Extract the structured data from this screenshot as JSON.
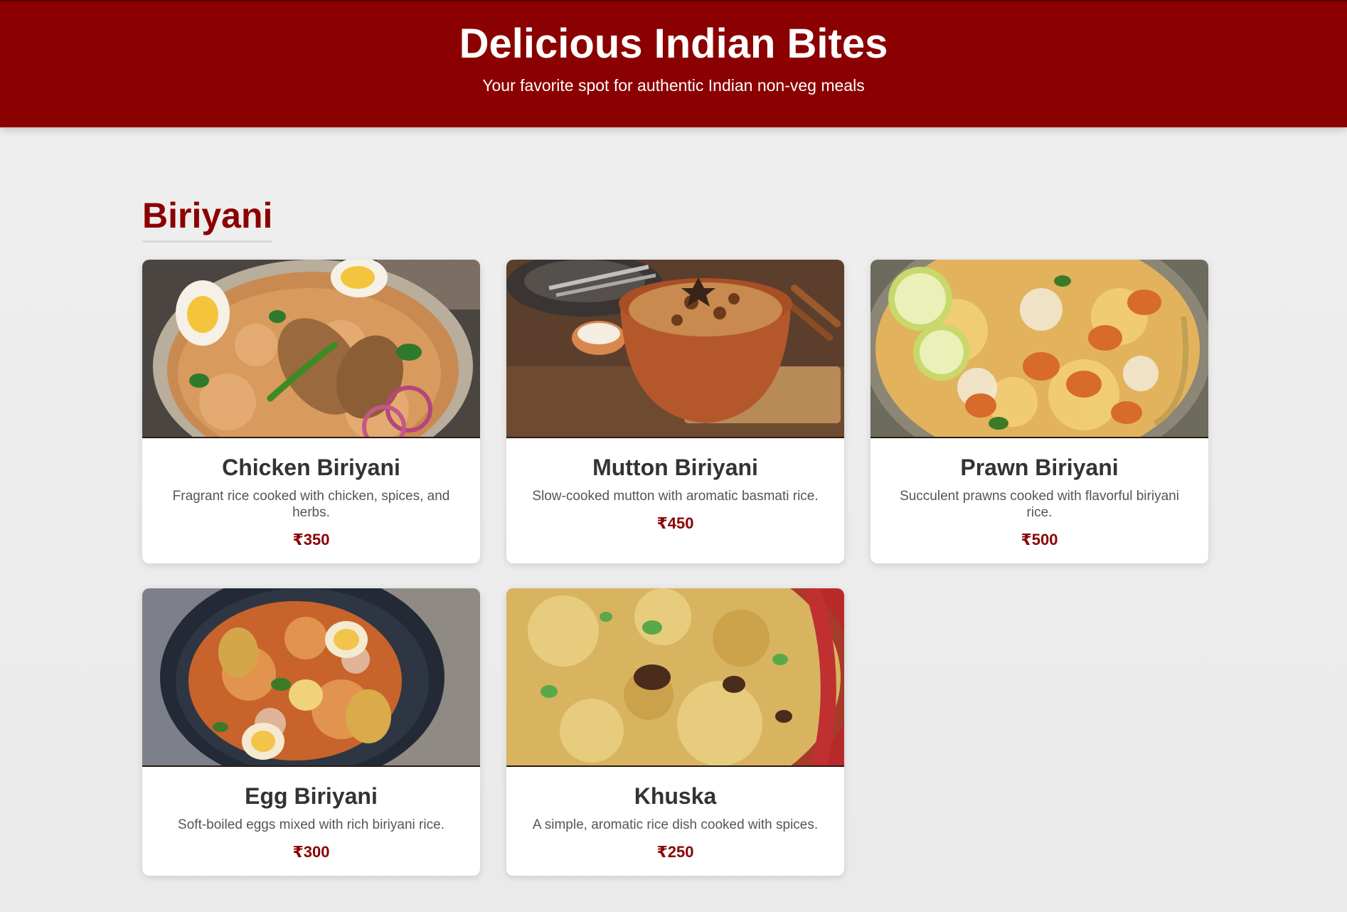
{
  "header": {
    "title": "Delicious Indian Bites",
    "tagline": "Your favorite spot for authentic Indian non-veg meals"
  },
  "section": {
    "title": "Biriyani"
  },
  "items": [
    {
      "name": "Chicken Biriyani",
      "description": "Fragrant rice cooked with chicken, spices, and herbs.",
      "price": "₹350"
    },
    {
      "name": "Mutton Biriyani",
      "description": "Slow-cooked mutton with aromatic basmati rice.",
      "price": "₹450"
    },
    {
      "name": "Prawn Biriyani",
      "description": "Succulent prawns cooked with flavorful biriyani rice.",
      "price": "₹500"
    },
    {
      "name": "Egg Biriyani",
      "description": "Soft-boiled eggs mixed with rich biriyani rice.",
      "price": "₹300"
    },
    {
      "name": "Khuska",
      "description": "A simple, aromatic rice dish cooked with spices.",
      "price": "₹250"
    }
  ],
  "colors": {
    "brand": "#8b0000",
    "page_background": "#eeeeee",
    "card_background": "#ffffff",
    "title_text": "#333333",
    "body_text": "#555555"
  }
}
